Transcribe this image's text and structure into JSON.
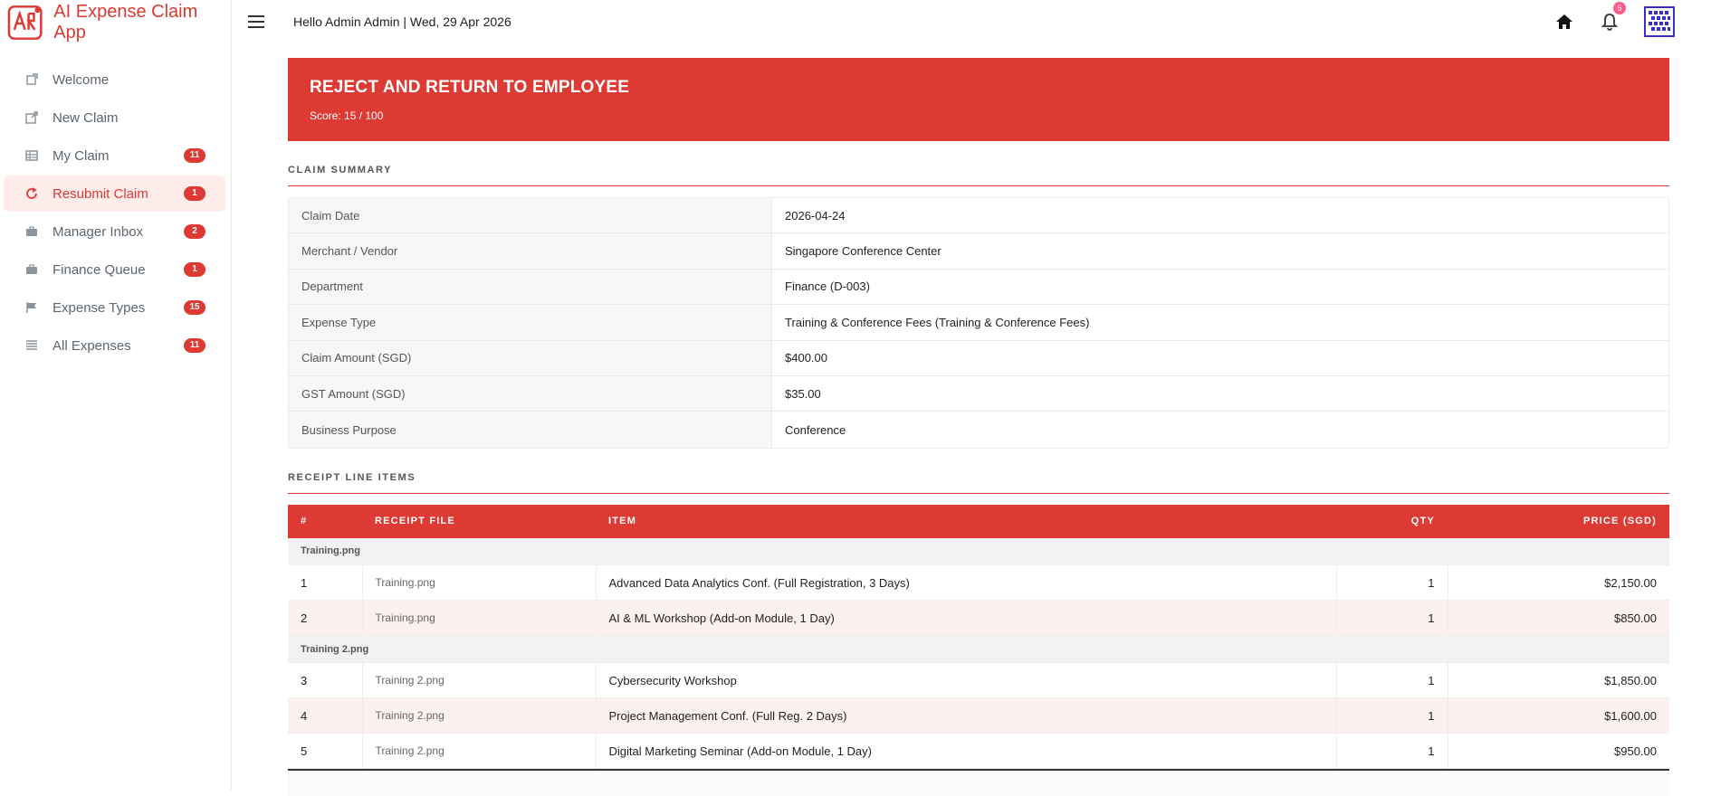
{
  "app": {
    "title": "AI Expense Claim App",
    "accent": "#dc3a33"
  },
  "header": {
    "greeting": "Hello Admin Admin | Wed, 29 Apr 2026",
    "notification_count": "5"
  },
  "sidebar": {
    "items": [
      {
        "label": "Welcome",
        "icon": "welcome-icon",
        "badge": ""
      },
      {
        "label": "New Claim",
        "icon": "external-link-icon",
        "badge": ""
      },
      {
        "label": "My Claim",
        "icon": "table-icon",
        "badge": "11"
      },
      {
        "label": "Resubmit Claim",
        "icon": "refresh-icon",
        "badge": "1"
      },
      {
        "label": "Manager Inbox",
        "icon": "briefcase-icon",
        "badge": "2"
      },
      {
        "label": "Finance Queue",
        "icon": "briefcase-icon",
        "badge": "1"
      },
      {
        "label": "Expense Types",
        "icon": "flag-icon",
        "badge": "15"
      },
      {
        "label": "All Expenses",
        "icon": "list-icon",
        "badge": "11"
      }
    ]
  },
  "verdict": {
    "title": "REJECT AND RETURN TO EMPLOYEE",
    "score": "Score: 15 / 100"
  },
  "summary": {
    "heading": "CLAIM SUMMARY",
    "rows": [
      {
        "label": "Claim Date",
        "value": "2026-04-24"
      },
      {
        "label": "Merchant / Vendor",
        "value": "Singapore Conference Center"
      },
      {
        "label": "Department",
        "value": "Finance (D-003)"
      },
      {
        "label": "Expense Type",
        "value": "Training & Conference Fees (Training & Conference Fees)"
      },
      {
        "label": "Claim Amount (SGD)",
        "value": "$400.00"
      },
      {
        "label": "GST Amount (SGD)",
        "value": "$35.00"
      },
      {
        "label": "Business Purpose",
        "value": "Conference"
      }
    ]
  },
  "receipts": {
    "heading": "RECEIPT LINE ITEMS",
    "columns": {
      "num": "#",
      "file": "RECEIPT FILE",
      "item": "ITEM",
      "qty": "QTY",
      "price": "PRICE (SGD)"
    },
    "groups": [
      {
        "name": "Training.png",
        "rows": [
          {
            "num": "1",
            "file": "Training.png",
            "item": "Advanced Data Analytics Conf. (Full Registration, 3 Days)",
            "qty": "1",
            "price": "$2,150.00"
          },
          {
            "num": "2",
            "file": "Training.png",
            "item": "AI & ML Workshop (Add-on Module, 1 Day)",
            "qty": "1",
            "price": "$850.00"
          }
        ]
      },
      {
        "name": "Training 2.png",
        "rows": [
          {
            "num": "3",
            "file": "Training 2.png",
            "item": "Cybersecurity Workshop",
            "qty": "1",
            "price": "$1,850.00"
          },
          {
            "num": "4",
            "file": "Training 2.png",
            "item": "Project Management Conf. (Full Reg. 2 Days)",
            "qty": "1",
            "price": "$1,600.00"
          },
          {
            "num": "5",
            "file": "Training 2.png",
            "item": "Digital Marketing Seminar (Add-on Module, 1 Day)",
            "qty": "1",
            "price": "$950.00"
          }
        ]
      }
    ]
  }
}
